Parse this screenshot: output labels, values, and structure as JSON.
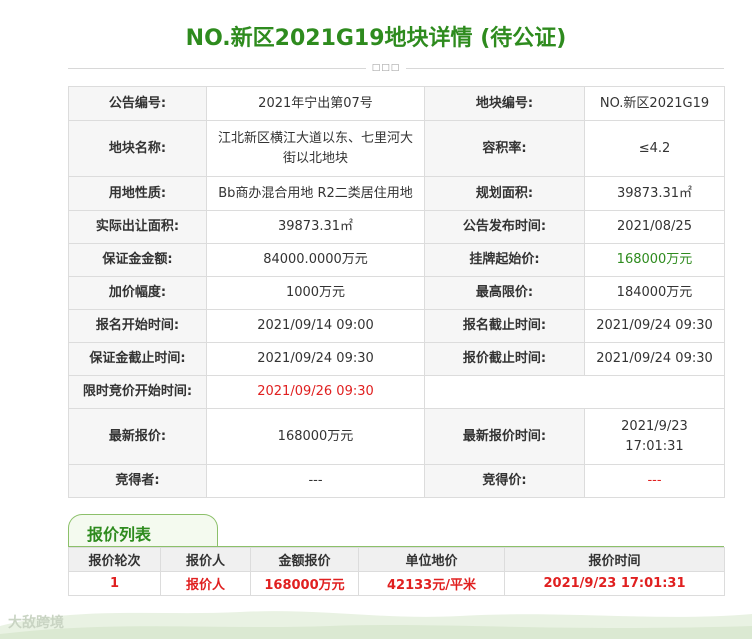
{
  "page": {
    "title": "NO.新区2021G19地块详情 (待公证)"
  },
  "divider_icon": "dots-ornament-icon",
  "info_rows": [
    [
      {
        "label": "公告编号:",
        "value": "2021年宁出第07号"
      },
      {
        "label": "地块编号:",
        "value": "NO.新区2021G19"
      }
    ],
    [
      {
        "label": "地块名称:",
        "value": "江北新区横江大道以东、七里河大街以北地块"
      },
      {
        "label": "容积率:",
        "value": "≤4.2"
      }
    ],
    [
      {
        "label": "用地性质:",
        "value": "Bb商办混合用地 R2二类居住用地"
      },
      {
        "label": "规划面积:",
        "value": "39873.31㎡"
      }
    ],
    [
      {
        "label": "实际出让面积:",
        "value": "39873.31㎡"
      },
      {
        "label": "公告发布时间:",
        "value": "2021/08/25"
      }
    ],
    [
      {
        "label": "保证金金额:",
        "value": "84000.0000万元"
      },
      {
        "label": "挂牌起始价:",
        "value": "168000万元"
      }
    ],
    [
      {
        "label": "加价幅度:",
        "value": "1000万元"
      },
      {
        "label": "最高限价:",
        "value": "184000万元"
      }
    ],
    [
      {
        "label": "报名开始时间:",
        "value": "2021/09/14 09:00"
      },
      {
        "label": "报名截止时间:",
        "value": "2021/09/24 09:30"
      }
    ],
    [
      {
        "label": "保证金截止时间:",
        "value": "2021/09/24 09:30"
      },
      {
        "label": "报价截止时间:",
        "value": "2021/09/24 09:30"
      }
    ],
    [
      {
        "label": "限时竞价开始时间:",
        "value": "2021/09/26 09:30"
      }
    ],
    [
      {
        "label": "最新报价:",
        "value": "168000万元"
      },
      {
        "label": "最新报价时间:",
        "value_line1": "2021/9/23",
        "value_line2": "17:01:31"
      }
    ],
    [
      {
        "label": "竞得者:",
        "value": "---"
      },
      {
        "label": "竞得价:",
        "value": "---"
      }
    ]
  ],
  "bid_section": {
    "tab_label": "报价列表",
    "headers": [
      "报价轮次",
      "报价人",
      "金额报价",
      "单位地价",
      "报价时间"
    ],
    "rows": [
      [
        "1",
        "报价人",
        "168000万元",
        "42133元/平米",
        "2021/9/23 17:01:31"
      ]
    ]
  },
  "watermark": "大敌跨境",
  "colors": {
    "title_green": "#2e8b1e",
    "highlight_red": "#e02020",
    "label_bg": "#f6f6f6",
    "border": "#dcdcdc"
  }
}
